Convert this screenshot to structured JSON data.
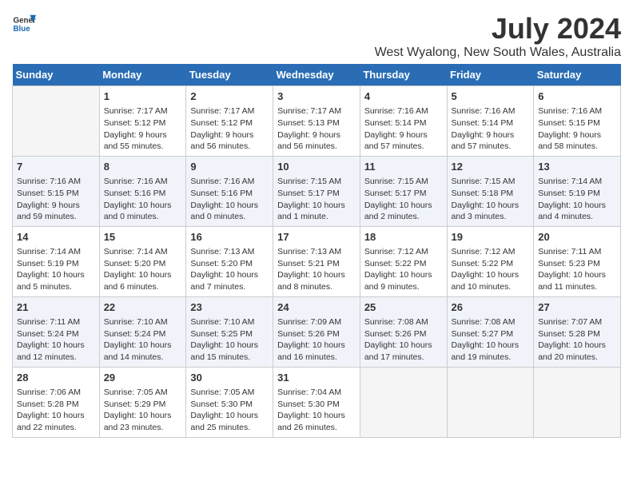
{
  "header": {
    "logo_general": "General",
    "logo_blue": "Blue",
    "month_title": "July 2024",
    "location": "West Wyalong, New South Wales, Australia"
  },
  "days_of_week": [
    "Sunday",
    "Monday",
    "Tuesday",
    "Wednesday",
    "Thursday",
    "Friday",
    "Saturday"
  ],
  "weeks": [
    [
      {
        "day": "",
        "sunrise": "",
        "sunset": "",
        "daylight": "",
        "empty": true
      },
      {
        "day": "1",
        "sunrise": "Sunrise: 7:17 AM",
        "sunset": "Sunset: 5:12 PM",
        "daylight": "Daylight: 9 hours and 55 minutes."
      },
      {
        "day": "2",
        "sunrise": "Sunrise: 7:17 AM",
        "sunset": "Sunset: 5:12 PM",
        "daylight": "Daylight: 9 hours and 56 minutes."
      },
      {
        "day": "3",
        "sunrise": "Sunrise: 7:17 AM",
        "sunset": "Sunset: 5:13 PM",
        "daylight": "Daylight: 9 hours and 56 minutes."
      },
      {
        "day": "4",
        "sunrise": "Sunrise: 7:16 AM",
        "sunset": "Sunset: 5:14 PM",
        "daylight": "Daylight: 9 hours and 57 minutes."
      },
      {
        "day": "5",
        "sunrise": "Sunrise: 7:16 AM",
        "sunset": "Sunset: 5:14 PM",
        "daylight": "Daylight: 9 hours and 57 minutes."
      },
      {
        "day": "6",
        "sunrise": "Sunrise: 7:16 AM",
        "sunset": "Sunset: 5:15 PM",
        "daylight": "Daylight: 9 hours and 58 minutes."
      }
    ],
    [
      {
        "day": "7",
        "sunrise": "Sunrise: 7:16 AM",
        "sunset": "Sunset: 5:15 PM",
        "daylight": "Daylight: 9 hours and 59 minutes."
      },
      {
        "day": "8",
        "sunrise": "Sunrise: 7:16 AM",
        "sunset": "Sunset: 5:16 PM",
        "daylight": "Daylight: 10 hours and 0 minutes."
      },
      {
        "day": "9",
        "sunrise": "Sunrise: 7:16 AM",
        "sunset": "Sunset: 5:16 PM",
        "daylight": "Daylight: 10 hours and 0 minutes."
      },
      {
        "day": "10",
        "sunrise": "Sunrise: 7:15 AM",
        "sunset": "Sunset: 5:17 PM",
        "daylight": "Daylight: 10 hours and 1 minute."
      },
      {
        "day": "11",
        "sunrise": "Sunrise: 7:15 AM",
        "sunset": "Sunset: 5:17 PM",
        "daylight": "Daylight: 10 hours and 2 minutes."
      },
      {
        "day": "12",
        "sunrise": "Sunrise: 7:15 AM",
        "sunset": "Sunset: 5:18 PM",
        "daylight": "Daylight: 10 hours and 3 minutes."
      },
      {
        "day": "13",
        "sunrise": "Sunrise: 7:14 AM",
        "sunset": "Sunset: 5:19 PM",
        "daylight": "Daylight: 10 hours and 4 minutes."
      }
    ],
    [
      {
        "day": "14",
        "sunrise": "Sunrise: 7:14 AM",
        "sunset": "Sunset: 5:19 PM",
        "daylight": "Daylight: 10 hours and 5 minutes."
      },
      {
        "day": "15",
        "sunrise": "Sunrise: 7:14 AM",
        "sunset": "Sunset: 5:20 PM",
        "daylight": "Daylight: 10 hours and 6 minutes."
      },
      {
        "day": "16",
        "sunrise": "Sunrise: 7:13 AM",
        "sunset": "Sunset: 5:20 PM",
        "daylight": "Daylight: 10 hours and 7 minutes."
      },
      {
        "day": "17",
        "sunrise": "Sunrise: 7:13 AM",
        "sunset": "Sunset: 5:21 PM",
        "daylight": "Daylight: 10 hours and 8 minutes."
      },
      {
        "day": "18",
        "sunrise": "Sunrise: 7:12 AM",
        "sunset": "Sunset: 5:22 PM",
        "daylight": "Daylight: 10 hours and 9 minutes."
      },
      {
        "day": "19",
        "sunrise": "Sunrise: 7:12 AM",
        "sunset": "Sunset: 5:22 PM",
        "daylight": "Daylight: 10 hours and 10 minutes."
      },
      {
        "day": "20",
        "sunrise": "Sunrise: 7:11 AM",
        "sunset": "Sunset: 5:23 PM",
        "daylight": "Daylight: 10 hours and 11 minutes."
      }
    ],
    [
      {
        "day": "21",
        "sunrise": "Sunrise: 7:11 AM",
        "sunset": "Sunset: 5:24 PM",
        "daylight": "Daylight: 10 hours and 12 minutes."
      },
      {
        "day": "22",
        "sunrise": "Sunrise: 7:10 AM",
        "sunset": "Sunset: 5:24 PM",
        "daylight": "Daylight: 10 hours and 14 minutes."
      },
      {
        "day": "23",
        "sunrise": "Sunrise: 7:10 AM",
        "sunset": "Sunset: 5:25 PM",
        "daylight": "Daylight: 10 hours and 15 minutes."
      },
      {
        "day": "24",
        "sunrise": "Sunrise: 7:09 AM",
        "sunset": "Sunset: 5:26 PM",
        "daylight": "Daylight: 10 hours and 16 minutes."
      },
      {
        "day": "25",
        "sunrise": "Sunrise: 7:08 AM",
        "sunset": "Sunset: 5:26 PM",
        "daylight": "Daylight: 10 hours and 17 minutes."
      },
      {
        "day": "26",
        "sunrise": "Sunrise: 7:08 AM",
        "sunset": "Sunset: 5:27 PM",
        "daylight": "Daylight: 10 hours and 19 minutes."
      },
      {
        "day": "27",
        "sunrise": "Sunrise: 7:07 AM",
        "sunset": "Sunset: 5:28 PM",
        "daylight": "Daylight: 10 hours and 20 minutes."
      }
    ],
    [
      {
        "day": "28",
        "sunrise": "Sunrise: 7:06 AM",
        "sunset": "Sunset: 5:28 PM",
        "daylight": "Daylight: 10 hours and 22 minutes."
      },
      {
        "day": "29",
        "sunrise": "Sunrise: 7:05 AM",
        "sunset": "Sunset: 5:29 PM",
        "daylight": "Daylight: 10 hours and 23 minutes."
      },
      {
        "day": "30",
        "sunrise": "Sunrise: 7:05 AM",
        "sunset": "Sunset: 5:30 PM",
        "daylight": "Daylight: 10 hours and 25 minutes."
      },
      {
        "day": "31",
        "sunrise": "Sunrise: 7:04 AM",
        "sunset": "Sunset: 5:30 PM",
        "daylight": "Daylight: 10 hours and 26 minutes."
      },
      {
        "day": "",
        "sunrise": "",
        "sunset": "",
        "daylight": "",
        "empty": true
      },
      {
        "day": "",
        "sunrise": "",
        "sunset": "",
        "daylight": "",
        "empty": true
      },
      {
        "day": "",
        "sunrise": "",
        "sunset": "",
        "daylight": "",
        "empty": true
      }
    ]
  ]
}
